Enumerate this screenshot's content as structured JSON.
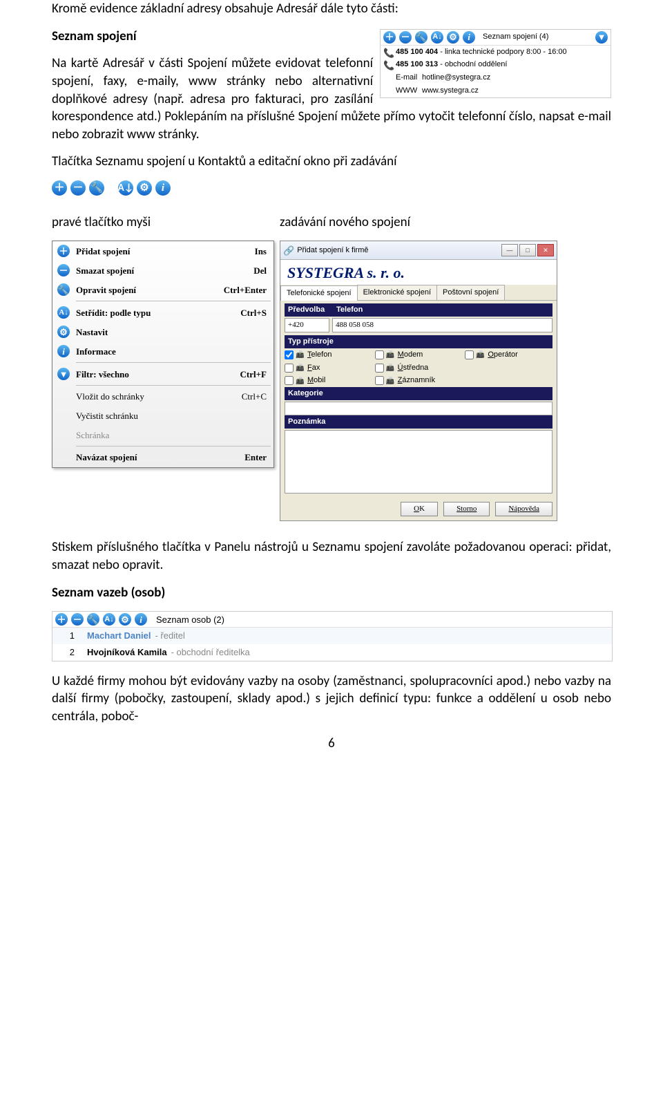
{
  "para1": "Kromě evidence základní adresy obsahuje Adresář dále tyto části:",
  "h1": "Seznam spojení",
  "para2": "Na kartě Adresář v části Spojení můžete evidovat telefonní spojení, faxy, e-maily, www stránky nebo alternativní doplňkové adresy (např. adresa pro fakturaci, pro zasílání korespondence atd.) Poklepáním na příslušné Spojení můžete přímo vytočit telefonní číslo, napsat e-mail nebo zobrazit www stránky.",
  "spanel": {
    "title": "Seznam spojení (4)",
    "rows": [
      {
        "icon": "📞",
        "bold": "485 100 404",
        "rest": " - linka technické podpory 8:00 - 16:00"
      },
      {
        "icon": "📞",
        "bold": "485 100 313",
        "rest": " - obchodní oddělení"
      },
      {
        "label": "E-mail",
        "bold": "hotline@systegra.cz"
      },
      {
        "label": "WWW",
        "bold": "www.systegra.cz"
      }
    ]
  },
  "para3": "Tlačítka Seznamu spojení u Kontaktů a editační okno při zadávání",
  "col_l_head": "pravé tlačítko myši",
  "col_r_head": "zadávání nového spojení",
  "menu": {
    "items": [
      {
        "icon": "plus",
        "bold": true,
        "label": "Přidat spojení",
        "sc": "Ins"
      },
      {
        "icon": "minus",
        "bold": true,
        "label": "Smazat spojení",
        "sc": "Del"
      },
      {
        "icon": "wrench",
        "bold": true,
        "label": "Opravit spojení",
        "sc": "Ctrl+Enter"
      },
      {
        "sep": true
      },
      {
        "icon": "sort",
        "bold": true,
        "label": "Setřídit: podle typu",
        "sc": "Ctrl+S"
      },
      {
        "icon": "gear",
        "bold": true,
        "label": "Nastavit",
        "sc": ""
      },
      {
        "icon": "info",
        "bold": true,
        "label": "Informace",
        "sc": ""
      },
      {
        "sep": true
      },
      {
        "icon": "funnel",
        "bold": true,
        "label": "Filtr: všechno",
        "sc": "Ctrl+F"
      },
      {
        "sep": true
      },
      {
        "label": "Vložit do schránky",
        "sc": "Ctrl+C"
      },
      {
        "label": "Vyčistit schránku",
        "sc": ""
      },
      {
        "label": "Schránka",
        "disabled": true
      },
      {
        "sep": true
      },
      {
        "bold": true,
        "label": "Navázat spojení",
        "sc": "Enter"
      }
    ]
  },
  "dlg": {
    "title": "Přidat spojení k firmě",
    "company": "SYSTEGRA s. r. o.",
    "tabs": [
      "Telefonické spojení",
      "Elektronické spojení",
      "Poštovní spojení"
    ],
    "col_pre": "Předvolba",
    "col_tel": "Telefon",
    "prefix": "+420",
    "number": "488 058 058",
    "sec_typ": "Typ přístroje",
    "devices": [
      {
        "l": "Telefon",
        "c": true
      },
      {
        "l": "Modem",
        "c": false
      },
      {
        "l": "Operátor",
        "c": false
      },
      {
        "l": "Fax",
        "c": false
      },
      {
        "l": "Ústředna",
        "c": false
      },
      {
        "l": "",
        "skip": true
      },
      {
        "l": "Mobil",
        "c": false
      },
      {
        "l": "Záznamník",
        "c": false
      },
      {
        "l": "",
        "skip": true
      }
    ],
    "sec_kat": "Kategorie",
    "sec_poz": "Poznámka",
    "btn_ok": "OK",
    "btn_storno": "Storno",
    "btn_nap": "Nápověda"
  },
  "para4": "Stiskem příslušného tlačítka v Panelu nástrojů u Seznamu spojení zavoláte požadovanou operaci: přidat, smazat nebo opravit.",
  "h2": "Seznam vazeb (osob)",
  "opanel": {
    "title": "Seznam osob (2)",
    "rows": [
      {
        "n": "1",
        "name": "Machart Daniel",
        "role": " - ředitel"
      },
      {
        "n": "2",
        "name": "Hvojníková Kamila",
        "role": " - obchodní ředitelka"
      }
    ]
  },
  "para5": "U každé firmy mohou být evidovány vazby na osoby (zaměstnanci, spolupracovníci apod.) nebo vazby na další firmy (pobočky, zastoupení, sklady apod.) s jejich definicí typu: funkce a oddělení u osob nebo centrála, poboč-",
  "pagenum": "6"
}
